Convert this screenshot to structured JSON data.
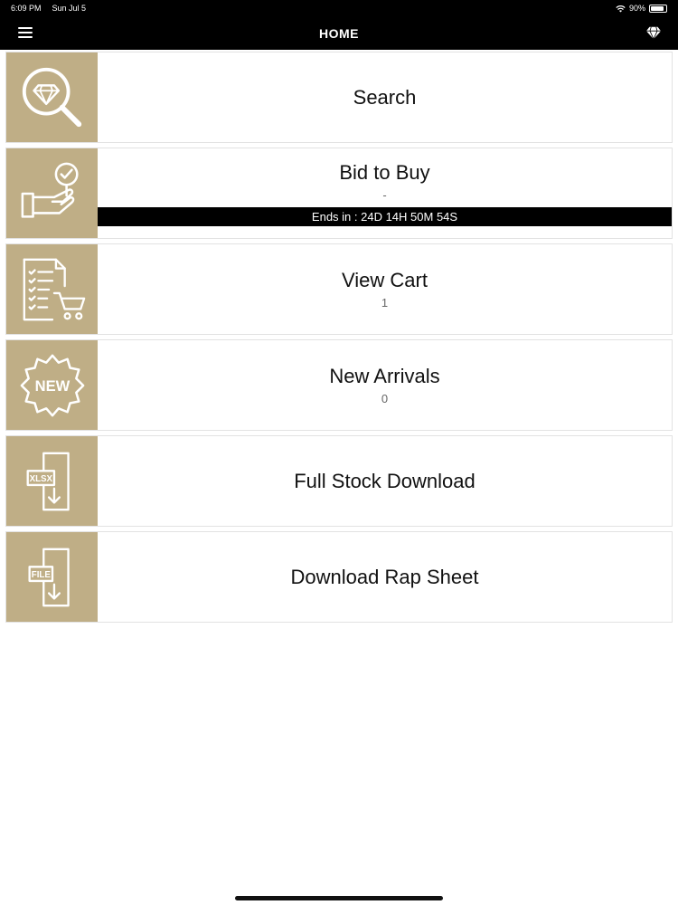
{
  "status_bar": {
    "time": "6:09 PM",
    "date": "Sun Jul 5",
    "battery": "90%",
    "battery_level": 0.9
  },
  "nav": {
    "title": "HOME",
    "menu_icon": "hamburger-menu-icon",
    "right_icon": "diamond-icon"
  },
  "theme": {
    "tile_color": "#bfae86",
    "nav_background": "#000000"
  },
  "items": [
    {
      "title": "Search",
      "icon": "diamond-search-icon"
    },
    {
      "title": "Bid to Buy",
      "count": "-",
      "timer": "Ends in : 24D 14H 50M 54S",
      "icon": "hand-bid-icon"
    },
    {
      "title": "View Cart",
      "count": "1",
      "icon": "cart-checklist-icon"
    },
    {
      "title": "New Arrivals",
      "count": "0",
      "icon": "new-badge-icon"
    },
    {
      "title": "Full Stock Download",
      "icon": "xlsx-download-icon",
      "icon_label": "XLSX"
    },
    {
      "title": "Download Rap Sheet",
      "icon": "file-download-icon",
      "icon_label": "FILE"
    }
  ]
}
